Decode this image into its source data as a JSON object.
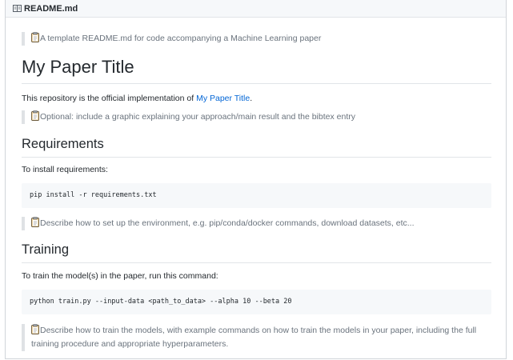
{
  "file": {
    "name": "README.md",
    "icon": "book-icon"
  },
  "readme": {
    "intro_note": "A template README.md for code accompanying a Machine Learning paper",
    "title": "My Paper Title",
    "official_text": "This repository is the official implementation of ",
    "official_link": "My Paper Title",
    "official_suffix": ".",
    "optional_note": "Optional: include a graphic explaining your approach/main result and the bibtex entry",
    "requirements": {
      "heading": "Requirements",
      "intro": "To install requirements:",
      "command": "pip install -r requirements.txt",
      "note": "Describe how to set up the environment, e.g. pip/conda/docker commands, download datasets, etc..."
    },
    "training": {
      "heading": "Training",
      "intro": "To train the model(s) in the paper, run this command:",
      "command": "python train.py --input-data <path_to_data> --alpha 10 --beta 20",
      "note": "Describe how to train the models, with example commands on how to train the models in your paper, including the full training procedure and appropriate hyperparameters."
    }
  },
  "colors": {
    "link": "#0366d6",
    "quote_text": "#6a737d",
    "code_bg": "#f6f8fa",
    "border": "#e1e4e8"
  }
}
